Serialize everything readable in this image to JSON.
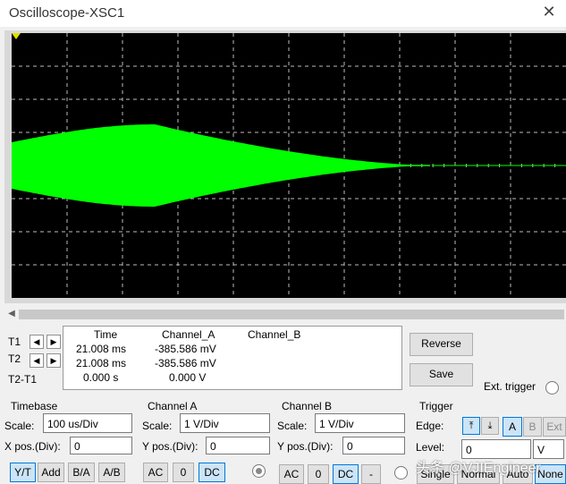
{
  "window": {
    "title": "Oscilloscope-XSC1"
  },
  "readout": {
    "col_time": "Time",
    "col_a": "Channel_A",
    "col_b": "Channel_B",
    "t1_label": "T1",
    "t2_label": "T2",
    "t2t1_label": "T2-T1",
    "t1_time": "21.008 ms",
    "t1_a": "-385.586 mV",
    "t2_time": "21.008 ms",
    "t2_a": "-385.586 mV",
    "d_time": "0.000 s",
    "d_a": "0.000 V"
  },
  "buttons": {
    "reverse": "Reverse",
    "save": "Save",
    "ext_trigger": "Ext. trigger"
  },
  "timebase": {
    "title": "Timebase",
    "scale_label": "Scale:",
    "scale": "100 us/Div",
    "xpos_label": "X pos.(Div):",
    "xpos": "0",
    "modes": [
      "Y/T",
      "Add",
      "B/A",
      "A/B"
    ]
  },
  "channel_a": {
    "title": "Channel A",
    "scale_label": "Scale:",
    "scale": "1  V/Div",
    "ypos_label": "Y pos.(Div):",
    "ypos": "0",
    "coupling": [
      "AC",
      "0",
      "DC"
    ]
  },
  "channel_b": {
    "title": "Channel B",
    "scale_label": "Scale:",
    "scale": "1  V/Div",
    "ypos_label": "Y pos.(Div):",
    "ypos": "0",
    "coupling": [
      "AC",
      "0",
      "DC",
      "-"
    ]
  },
  "trigger": {
    "title": "Trigger",
    "edge_label": "Edge:",
    "sources": [
      "A",
      "B",
      "Ext"
    ],
    "level_label": "Level:",
    "level": "0",
    "level_unit": "V",
    "modes": [
      "Single",
      "Normal",
      "Auto",
      "None"
    ]
  },
  "watermark": "头条 @VJIEngineer",
  "colors": {
    "trace": "#00ff00",
    "screen": "#000000",
    "grid": "#bdbdbd"
  }
}
